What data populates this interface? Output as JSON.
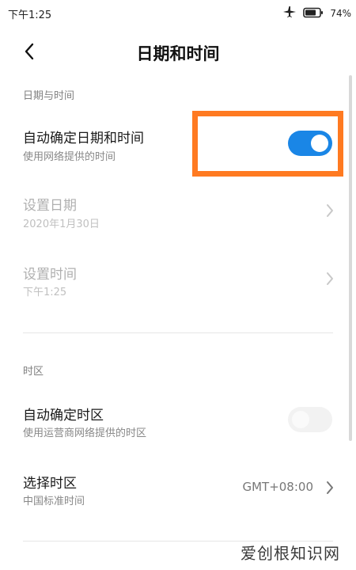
{
  "status_bar": {
    "time": "下午1:25",
    "battery_percent": "74%",
    "icons": [
      "airplane-icon",
      "battery-icon"
    ]
  },
  "title_bar": {
    "title": "日期和时间",
    "back_icon": "chevron-left-icon"
  },
  "sections": {
    "date_time": {
      "header": "日期与时间",
      "auto_date_time": {
        "title": "自动确定日期和时间",
        "subtitle": "使用网络提供的时间",
        "enabled": true
      },
      "set_date": {
        "title": "设置日期",
        "value": "2020年1月30日"
      },
      "set_time": {
        "title": "设置时间",
        "value": "下午1:25"
      }
    },
    "time_zone": {
      "header": "时区",
      "auto_time_zone": {
        "title": "自动确定时区",
        "subtitle": "使用运营商网络提供的时区",
        "enabled": false
      },
      "select_time_zone": {
        "title": "选择时区",
        "subtitle": "中国标准时间",
        "value": "GMT+08:00"
      }
    }
  },
  "colors": {
    "toggle_on": "#1a86e6",
    "highlight": "#ff7a21",
    "disabled_text": "#b0b0b0"
  },
  "watermark": "爱创根知识网"
}
